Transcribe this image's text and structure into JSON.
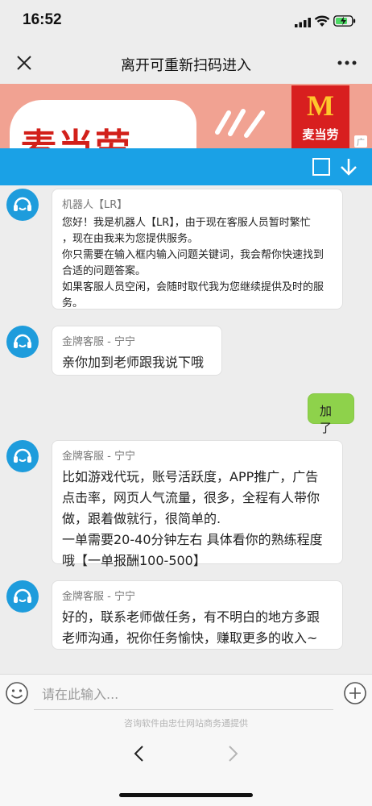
{
  "status_bar": {
    "time": "16:52"
  },
  "nav": {
    "title": "离开可重新扫码进入"
  },
  "banner": {
    "brand_text": "麦当劳",
    "logo_mark": "M",
    "logo_label": "麦当劳",
    "ad_tag": "广"
  },
  "messages": [
    {
      "from": "agent",
      "sender": "机器人【LR】",
      "lines": [
        "您好！我是机器人【LR】，由于现在客服人员暂时繁忙",
        "，现在由我来为您提供服务。",
        "你只需要在输入框内输入问题关键词，我会帮你快速找到",
        "合适的问题答案。",
        "如果客服人员空闲，会随时取代我为您继续提供及时的服",
        "务。"
      ]
    },
    {
      "from": "agent",
      "sender": "金牌客服 - 宁宁",
      "lines": [
        "亲你加到老师跟我说下哦"
      ]
    },
    {
      "from": "me",
      "text": "加了"
    },
    {
      "from": "agent",
      "sender": "金牌客服 - 宁宁",
      "lines": [
        "比如游戏代玩，账号活跃度，APP推广，广告",
        "点击率，网页人气流量，很多，全程有人带你",
        "做，跟着做就行，很简单的.",
        "一单需要20-40分钟左右 具体看你的熟练程度",
        "哦【一单报酬100-500】"
      ]
    },
    {
      "from": "agent",
      "sender": "金牌客服 - 宁宁",
      "lines": [
        "好的，联系老师做任务，有不明白的地方多跟",
        "老师沟通，祝你任务愉快，赚取更多的收入~"
      ]
    }
  ],
  "input": {
    "placeholder": "请在此输入...",
    "value": ""
  },
  "footer": {
    "powered_by": "咨询软件由忠仕网站商务通提供"
  },
  "icons": {
    "close": "close-icon",
    "more": "more-icon",
    "minimize": "minimize-icon",
    "download": "arrow-down-icon",
    "agent_avatar": "headset-icon",
    "emoji": "emoji-icon",
    "plus": "plus-icon",
    "back": "chevron-left-icon",
    "forward": "chevron-right-icon"
  },
  "colors": {
    "toolbar": "#1aa1e6",
    "avatar": "#1e9cdc",
    "my_bubble": "#8ed24b",
    "banner": "#f1a292",
    "logo_red": "#d81f1f",
    "logo_yellow": "#ffc72c"
  }
}
